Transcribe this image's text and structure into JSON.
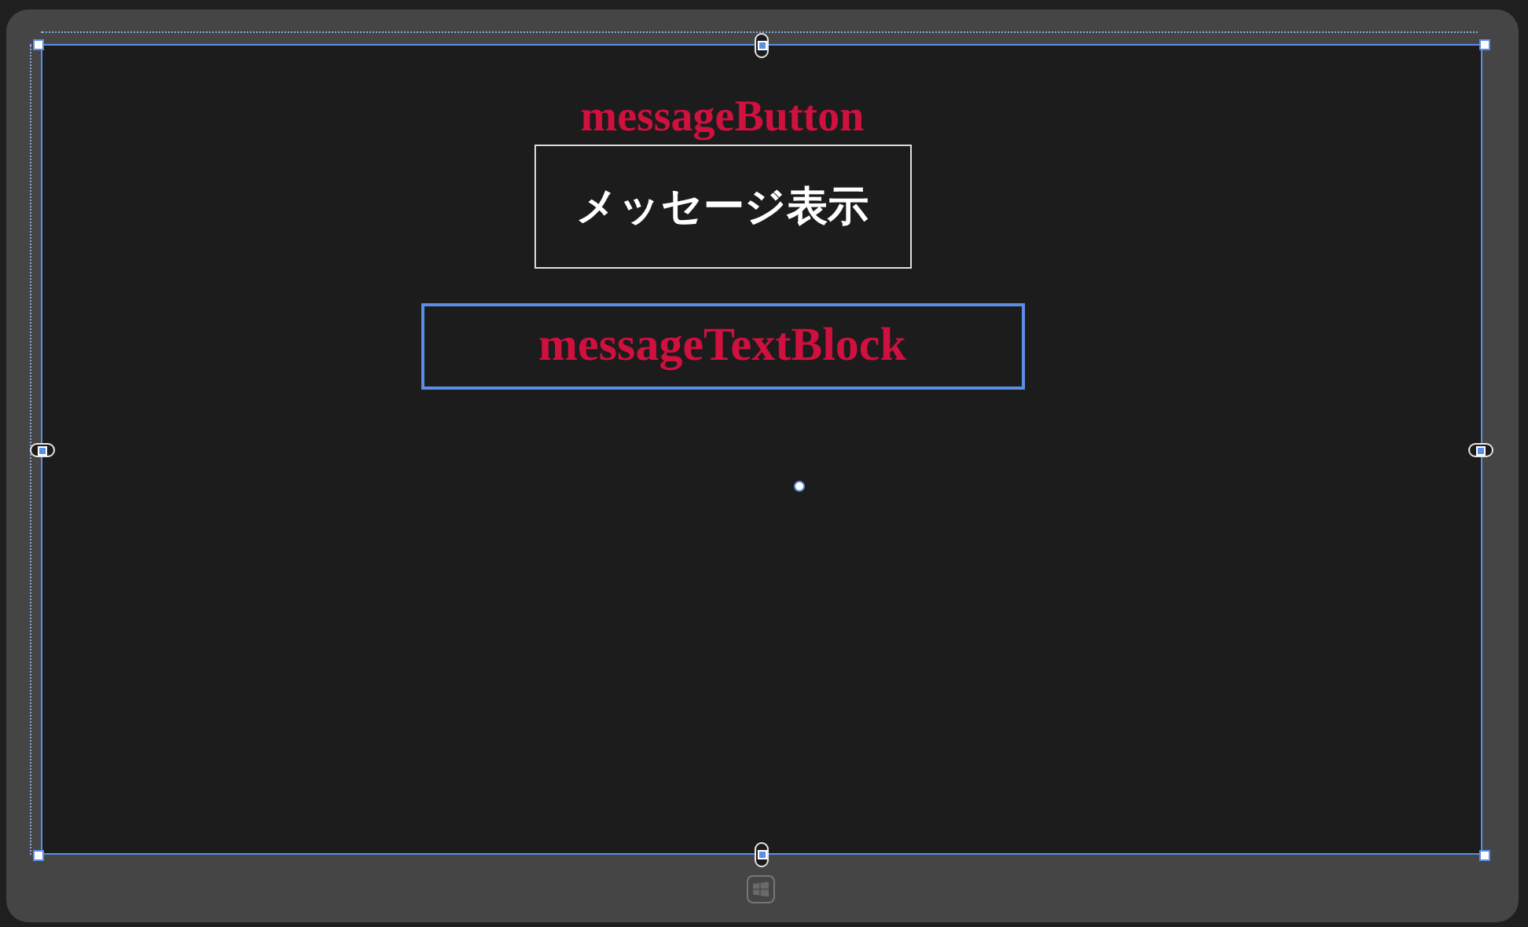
{
  "design_surface": {
    "button": {
      "name_label": "messageButton",
      "content": "メッセージ表示"
    },
    "text_block": {
      "name_label": "messageTextBlock"
    }
  }
}
